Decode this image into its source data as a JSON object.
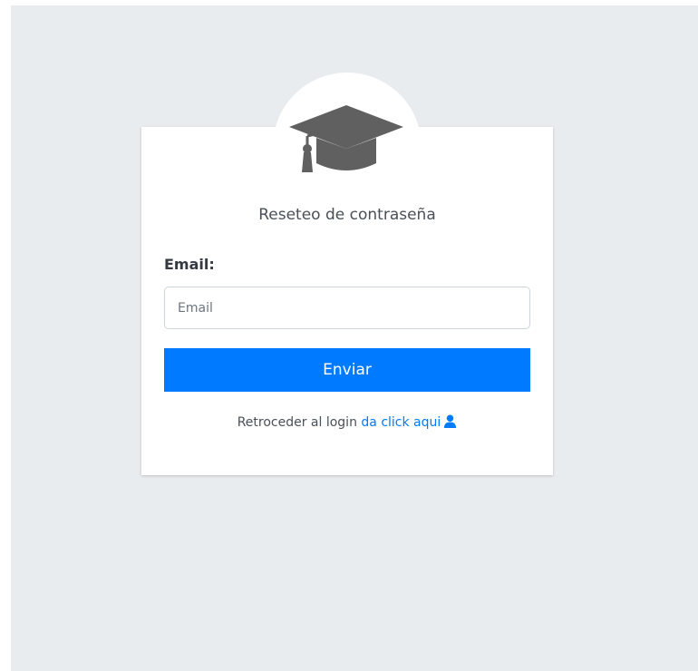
{
  "page": {
    "title": "Reseteo de contraseña"
  },
  "form": {
    "email_label": "Email:",
    "email_placeholder": "Email",
    "email_value": "",
    "submit_label": "Enviar"
  },
  "footer": {
    "back_text": "Retroceder al login",
    "link_text": "da click aqui",
    "link_icon": "user-icon"
  },
  "icons": {
    "logo": "graduation-cap-icon"
  },
  "colors": {
    "background": "#e9ecef",
    "card": "#ffffff",
    "accent": "#007bff",
    "logo": "#606060"
  }
}
